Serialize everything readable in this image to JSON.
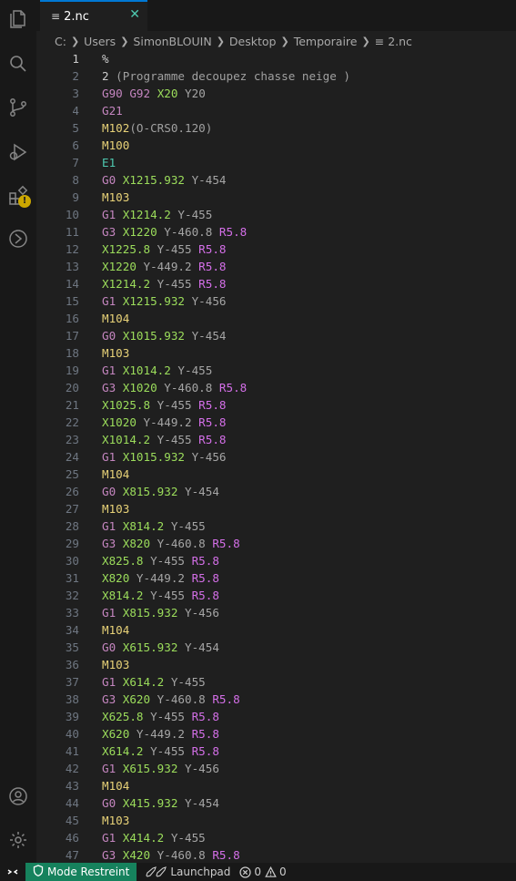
{
  "tab": {
    "title": "2.nc",
    "close_glyph": "✕"
  },
  "breadcrumb": [
    "C:",
    "Users",
    "SimonBLOUIN",
    "Desktop",
    "Temporaire",
    "2.nc"
  ],
  "activity_icons": [
    "files-icon",
    "search-icon",
    "source-control-icon",
    "run-debug-icon",
    "extensions-icon",
    "remote-explorer-icon",
    "account-icon",
    "settings-gear-icon"
  ],
  "editor": {
    "current_line": 1,
    "lines": [
      [
        [
          "%",
          "c"
        ]
      ],
      [
        [
          "2 ",
          "c"
        ],
        [
          "(Programme decoupez chasse neige )",
          "cm"
        ]
      ],
      [
        [
          "G90 ",
          "p"
        ],
        [
          "G92 ",
          "p"
        ],
        [
          "X20 ",
          "x"
        ],
        [
          "Y20",
          "y"
        ]
      ],
      [
        [
          "G21",
          "p"
        ]
      ],
      [
        [
          "M102",
          "mm"
        ],
        [
          "(O-CRS0.120)",
          "cm"
        ]
      ],
      [
        [
          "M100",
          "mm"
        ]
      ],
      [
        [
          "E1",
          "e"
        ]
      ],
      [
        [
          "G0 ",
          "p"
        ],
        [
          "X1215.932 ",
          "x"
        ],
        [
          "Y-454",
          "y"
        ]
      ],
      [
        [
          "M103",
          "mm"
        ]
      ],
      [
        [
          "G1 ",
          "p"
        ],
        [
          "X1214.2 ",
          "x"
        ],
        [
          "Y-455",
          "y"
        ]
      ],
      [
        [
          "G3 ",
          "p"
        ],
        [
          "X1220 ",
          "x"
        ],
        [
          "Y-460.8 ",
          "y"
        ],
        [
          "R5.8",
          "r"
        ]
      ],
      [
        [
          "X1225.8 ",
          "x"
        ],
        [
          "Y-455 ",
          "y"
        ],
        [
          "R5.8",
          "r"
        ]
      ],
      [
        [
          "X1220 ",
          "x"
        ],
        [
          "Y-449.2 ",
          "y"
        ],
        [
          "R5.8",
          "r"
        ]
      ],
      [
        [
          "X1214.2 ",
          "x"
        ],
        [
          "Y-455 ",
          "y"
        ],
        [
          "R5.8",
          "r"
        ]
      ],
      [
        [
          "G1 ",
          "p"
        ],
        [
          "X1215.932 ",
          "x"
        ],
        [
          "Y-456",
          "y"
        ]
      ],
      [
        [
          "M104",
          "mm"
        ]
      ],
      [
        [
          "G0 ",
          "p"
        ],
        [
          "X1015.932 ",
          "x"
        ],
        [
          "Y-454",
          "y"
        ]
      ],
      [
        [
          "M103",
          "mm"
        ]
      ],
      [
        [
          "G1 ",
          "p"
        ],
        [
          "X1014.2 ",
          "x"
        ],
        [
          "Y-455",
          "y"
        ]
      ],
      [
        [
          "G3 ",
          "p"
        ],
        [
          "X1020 ",
          "x"
        ],
        [
          "Y-460.8 ",
          "y"
        ],
        [
          "R5.8",
          "r"
        ]
      ],
      [
        [
          "X1025.8 ",
          "x"
        ],
        [
          "Y-455 ",
          "y"
        ],
        [
          "R5.8",
          "r"
        ]
      ],
      [
        [
          "X1020 ",
          "x"
        ],
        [
          "Y-449.2 ",
          "y"
        ],
        [
          "R5.8",
          "r"
        ]
      ],
      [
        [
          "X1014.2 ",
          "x"
        ],
        [
          "Y-455 ",
          "y"
        ],
        [
          "R5.8",
          "r"
        ]
      ],
      [
        [
          "G1 ",
          "p"
        ],
        [
          "X1015.932 ",
          "x"
        ],
        [
          "Y-456",
          "y"
        ]
      ],
      [
        [
          "M104",
          "mm"
        ]
      ],
      [
        [
          "G0 ",
          "p"
        ],
        [
          "X815.932 ",
          "x"
        ],
        [
          "Y-454",
          "y"
        ]
      ],
      [
        [
          "M103",
          "mm"
        ]
      ],
      [
        [
          "G1 ",
          "p"
        ],
        [
          "X814.2 ",
          "x"
        ],
        [
          "Y-455",
          "y"
        ]
      ],
      [
        [
          "G3 ",
          "p"
        ],
        [
          "X820 ",
          "x"
        ],
        [
          "Y-460.8 ",
          "y"
        ],
        [
          "R5.8",
          "r"
        ]
      ],
      [
        [
          "X825.8 ",
          "x"
        ],
        [
          "Y-455 ",
          "y"
        ],
        [
          "R5.8",
          "r"
        ]
      ],
      [
        [
          "X820 ",
          "x"
        ],
        [
          "Y-449.2 ",
          "y"
        ],
        [
          "R5.8",
          "r"
        ]
      ],
      [
        [
          "X814.2 ",
          "x"
        ],
        [
          "Y-455 ",
          "y"
        ],
        [
          "R5.8",
          "r"
        ]
      ],
      [
        [
          "G1 ",
          "p"
        ],
        [
          "X815.932 ",
          "x"
        ],
        [
          "Y-456",
          "y"
        ]
      ],
      [
        [
          "M104",
          "mm"
        ]
      ],
      [
        [
          "G0 ",
          "p"
        ],
        [
          "X615.932 ",
          "x"
        ],
        [
          "Y-454",
          "y"
        ]
      ],
      [
        [
          "M103",
          "mm"
        ]
      ],
      [
        [
          "G1 ",
          "p"
        ],
        [
          "X614.2 ",
          "x"
        ],
        [
          "Y-455",
          "y"
        ]
      ],
      [
        [
          "G3 ",
          "p"
        ],
        [
          "X620 ",
          "x"
        ],
        [
          "Y-460.8 ",
          "y"
        ],
        [
          "R5.8",
          "r"
        ]
      ],
      [
        [
          "X625.8 ",
          "x"
        ],
        [
          "Y-455 ",
          "y"
        ],
        [
          "R5.8",
          "r"
        ]
      ],
      [
        [
          "X620 ",
          "x"
        ],
        [
          "Y-449.2 ",
          "y"
        ],
        [
          "R5.8",
          "r"
        ]
      ],
      [
        [
          "X614.2 ",
          "x"
        ],
        [
          "Y-455 ",
          "y"
        ],
        [
          "R5.8",
          "r"
        ]
      ],
      [
        [
          "G1 ",
          "p"
        ],
        [
          "X615.932 ",
          "x"
        ],
        [
          "Y-456",
          "y"
        ]
      ],
      [
        [
          "M104",
          "mm"
        ]
      ],
      [
        [
          "G0 ",
          "p"
        ],
        [
          "X415.932 ",
          "x"
        ],
        [
          "Y-454",
          "y"
        ]
      ],
      [
        [
          "M103",
          "mm"
        ]
      ],
      [
        [
          "G1 ",
          "p"
        ],
        [
          "X414.2 ",
          "x"
        ],
        [
          "Y-455",
          "y"
        ]
      ],
      [
        [
          "G3 ",
          "p"
        ],
        [
          "X420 ",
          "x"
        ],
        [
          "Y-460.8 ",
          "y"
        ],
        [
          "R5.8",
          "r"
        ]
      ]
    ]
  },
  "statusbar": {
    "restricted_label": "Mode Restreint",
    "launchpad_label": "Launchpad",
    "errors": "0",
    "warnings": "0"
  },
  "colors": {
    "accent": "#0078d4",
    "restricted_bg": "#16825d",
    "warning": "#cca700"
  }
}
